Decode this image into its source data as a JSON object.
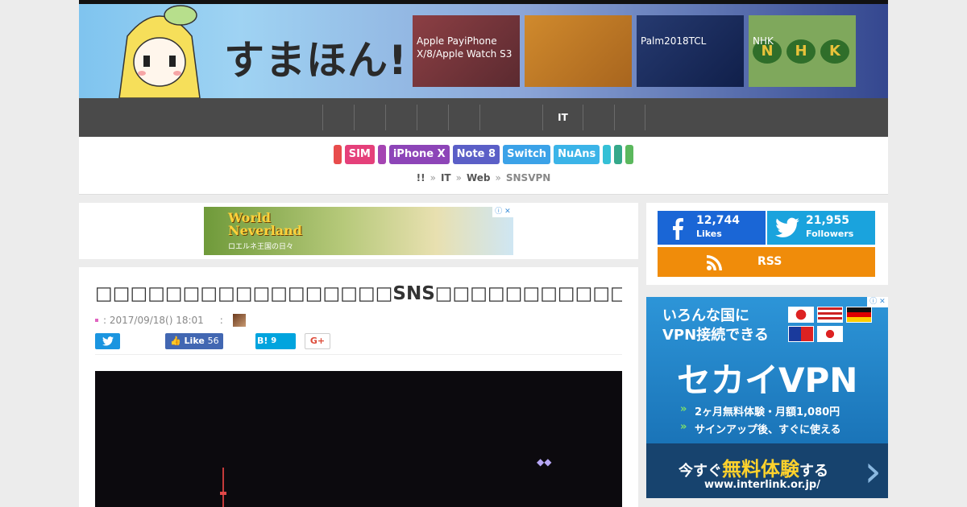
{
  "header": {
    "logo": "すまほん!!",
    "featured": [
      {
        "title": "Apple PayiPhone X/8/Apple Watch S3"
      },
      {
        "title": ""
      },
      {
        "title": "Palm2018TCL"
      },
      {
        "title": "NHK",
        "emblem": [
          "N",
          "H",
          "K"
        ]
      }
    ]
  },
  "nav": {
    "items": [
      "",
      "",
      "",
      "",
      "",
      "",
      "IT",
      "",
      ""
    ]
  },
  "tags": [
    {
      "label": "",
      "color": "#e84c4c"
    },
    {
      "label": "SIM",
      "color": "#e5407a"
    },
    {
      "label": "",
      "color": "#a445b2"
    },
    {
      "label": "iPhone X",
      "color": "#8d45b8"
    },
    {
      "label": "Note 8",
      "color": "#5b5fc7"
    },
    {
      "label": "Switch",
      "color": "#3ba2e8"
    },
    {
      "label": "NuAns",
      "color": "#3bb4e8"
    },
    {
      "label": "",
      "color": "#35c0d6"
    },
    {
      "label": "",
      "color": "#35a88a"
    },
    {
      "label": "",
      "color": "#5bb85d"
    }
  ],
  "breadcrumb": {
    "items": [
      "!!",
      "",
      "IT",
      "Web"
    ],
    "current": "SNSVPN"
  },
  "ad_top": {
    "title_line1": "World",
    "title_line2": "Neverland",
    "subtitle": "ロエルネ王国の日々"
  },
  "article": {
    "title": "□□□□□□□□□□□□□□□□□SNS□□□□□□□□□□□□□□□□□VPN□□□□□□□",
    "date": ": 2017/09/18() 18:01",
    "author_sep": ":",
    "share": {
      "facebook_label": "Like",
      "facebook_count": "56",
      "hatena_label": "B!",
      "hatena_count": "9",
      "gplus_label": "G+"
    }
  },
  "social": {
    "facebook": {
      "count": "12,744",
      "label": "Likes",
      "color": "#1a66d6"
    },
    "twitter": {
      "count": "21,955",
      "label": "Followers",
      "color": "#1aa3dd"
    },
    "rss": {
      "label": "RSS",
      "color": "#f08c0a"
    }
  },
  "vpn_ad": {
    "line1": "いろんな国に",
    "line2": "VPN接続できる",
    "brand": "セカイVPN",
    "point1": "2ヶ月無料体験・月額1,080円",
    "point2": "サインアップ後、すぐに使える",
    "cta_pre": "今すぐ",
    "cta_highlight": "無料体験",
    "cta_post": "する",
    "url": "www.interlink.or.jp/"
  }
}
